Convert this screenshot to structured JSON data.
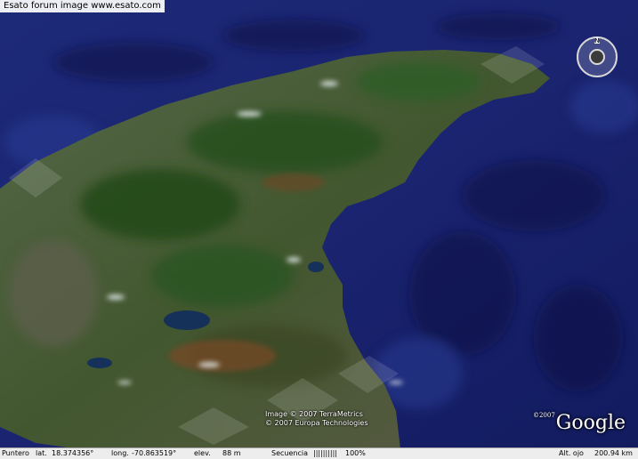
{
  "header": {
    "title": "Esato forum image www.esato.com"
  },
  "map": {
    "colors": {
      "ocean": "#16206a",
      "land": "#3f5a30",
      "forest": "#1f4a16",
      "lake": "#15315a"
    },
    "attribution": [
      "Image © 2007 TerraMetrics",
      "© 2007 Europa Technologies"
    ],
    "logo": {
      "prefix": "©2007",
      "brand": "Google"
    },
    "compass": {
      "north": "N"
    }
  },
  "statusbar": {
    "pointer_label": "Puntero",
    "lat_label": "lat.",
    "lat_value": "18.374356°",
    "long_label": "long.",
    "long_value": "-70.863519°",
    "elev_label": "elev.",
    "elev_value": "88 m",
    "stream_label": "Secuencia",
    "stream_bar": "||||||||||",
    "stream_percent": "100%",
    "eye_label": "Alt. ojo",
    "eye_value": "200.94 km"
  }
}
